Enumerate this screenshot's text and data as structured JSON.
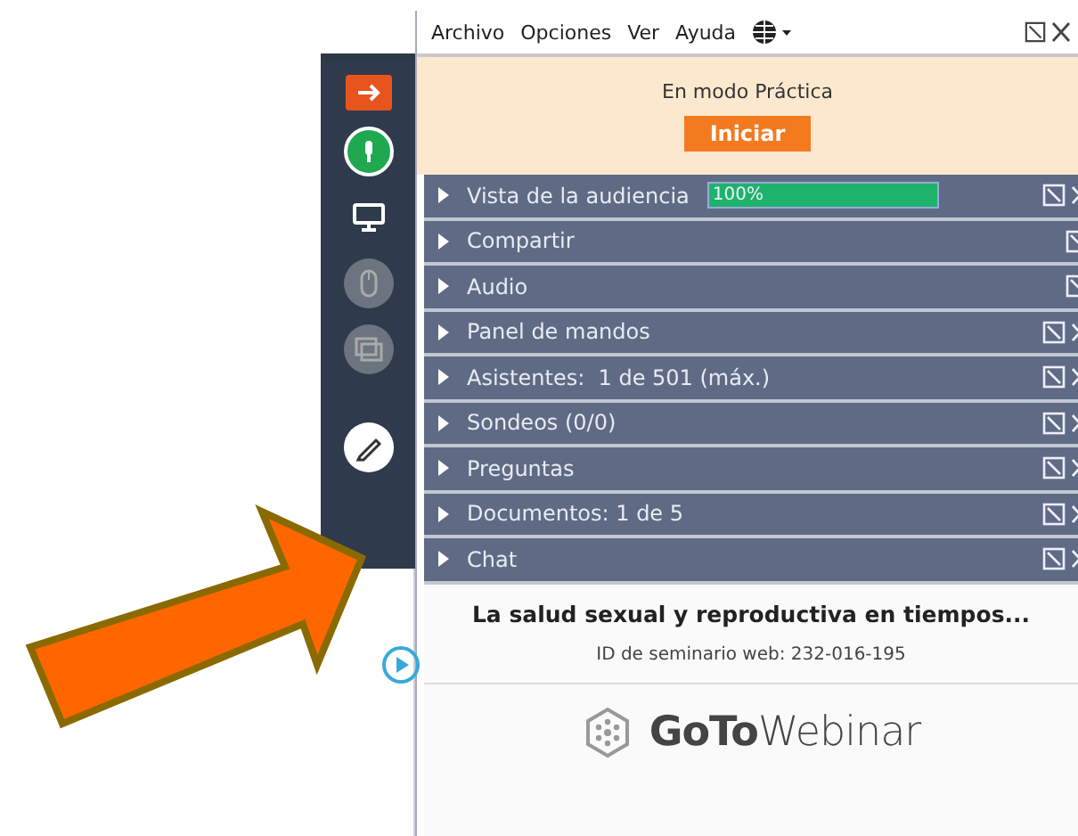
{
  "menu": [
    {
      "label": "Archivo"
    },
    {
      "label": "Opciones"
    },
    {
      "label": "Ver"
    },
    {
      "label": "Ayuda"
    }
  ],
  "banner": {
    "text": "En modo Práctica",
    "button": "Iniciar"
  },
  "panes": [
    {
      "label": "Vista de la audiencia",
      "meter": {
        "level": 1.0,
        "reading": "100%"
      },
      "closable": true
    },
    {
      "label": "Compartir",
      "closable": false
    },
    {
      "label": "Audio",
      "closable": false
    },
    {
      "label": "Panel de mandos",
      "closable": true
    },
    {
      "label": "Asistentes:  1 de 501 (máx.)",
      "closable": true
    },
    {
      "label": "Sondeos (0/0)",
      "closable": true
    },
    {
      "label": "Preguntas",
      "closable": true
    },
    {
      "label": "Documentos: 1 de 5",
      "closable": true
    },
    {
      "label": "Chat",
      "closable": true
    }
  ],
  "footer": {
    "title": "La salud sexual y reproductiva en tiempos...",
    "webinar_id": "ID de seminario web: 232-016-195",
    "logo": "**GoTo**Webinar"
  }
}
